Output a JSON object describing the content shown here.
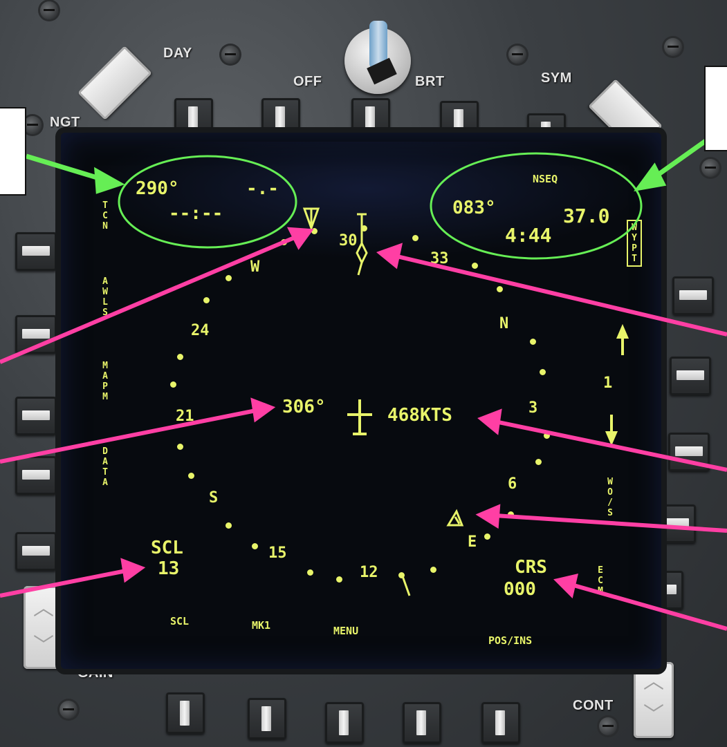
{
  "bezel": {
    "labels": {
      "day": "DAY",
      "ngt": "NGT",
      "off": "OFF",
      "brt": "BRT",
      "sym": "SYM",
      "gain": "GAIN",
      "cont": "CONT"
    }
  },
  "display": {
    "top_left": {
      "bearing": "290°",
      "distance": "-.-",
      "time": "--:--"
    },
    "top_right": {
      "mode": "NSEQ",
      "bearing": "083°",
      "distance": "37.0",
      "time": "4:44"
    },
    "center": {
      "heading": "306°",
      "speed": "468KTS"
    },
    "left_options": [
      "TCN",
      "AWLS",
      "MAPM",
      "DATA"
    ],
    "right_options": {
      "wypt": "WYPT",
      "wp_number": "1",
      "wos": "WO/S",
      "ecm": "ECM"
    },
    "scale": {
      "label": "SCL",
      "value": "13"
    },
    "course": {
      "label": "CRS",
      "value": "000"
    },
    "bottom_options": [
      "SCL",
      "MK1",
      "MENU",
      "POS/INS"
    ],
    "compass": {
      "labels": [
        "30",
        "33",
        "N",
        "3",
        "6",
        "E",
        "12",
        "15",
        "S",
        "21",
        "24",
        "W"
      ]
    }
  },
  "colors": {
    "symbology": "#e8f46a",
    "callout_green": "#66ee55",
    "callout_pink": "#ff3fa4",
    "screen_bg": "#070a0f"
  }
}
